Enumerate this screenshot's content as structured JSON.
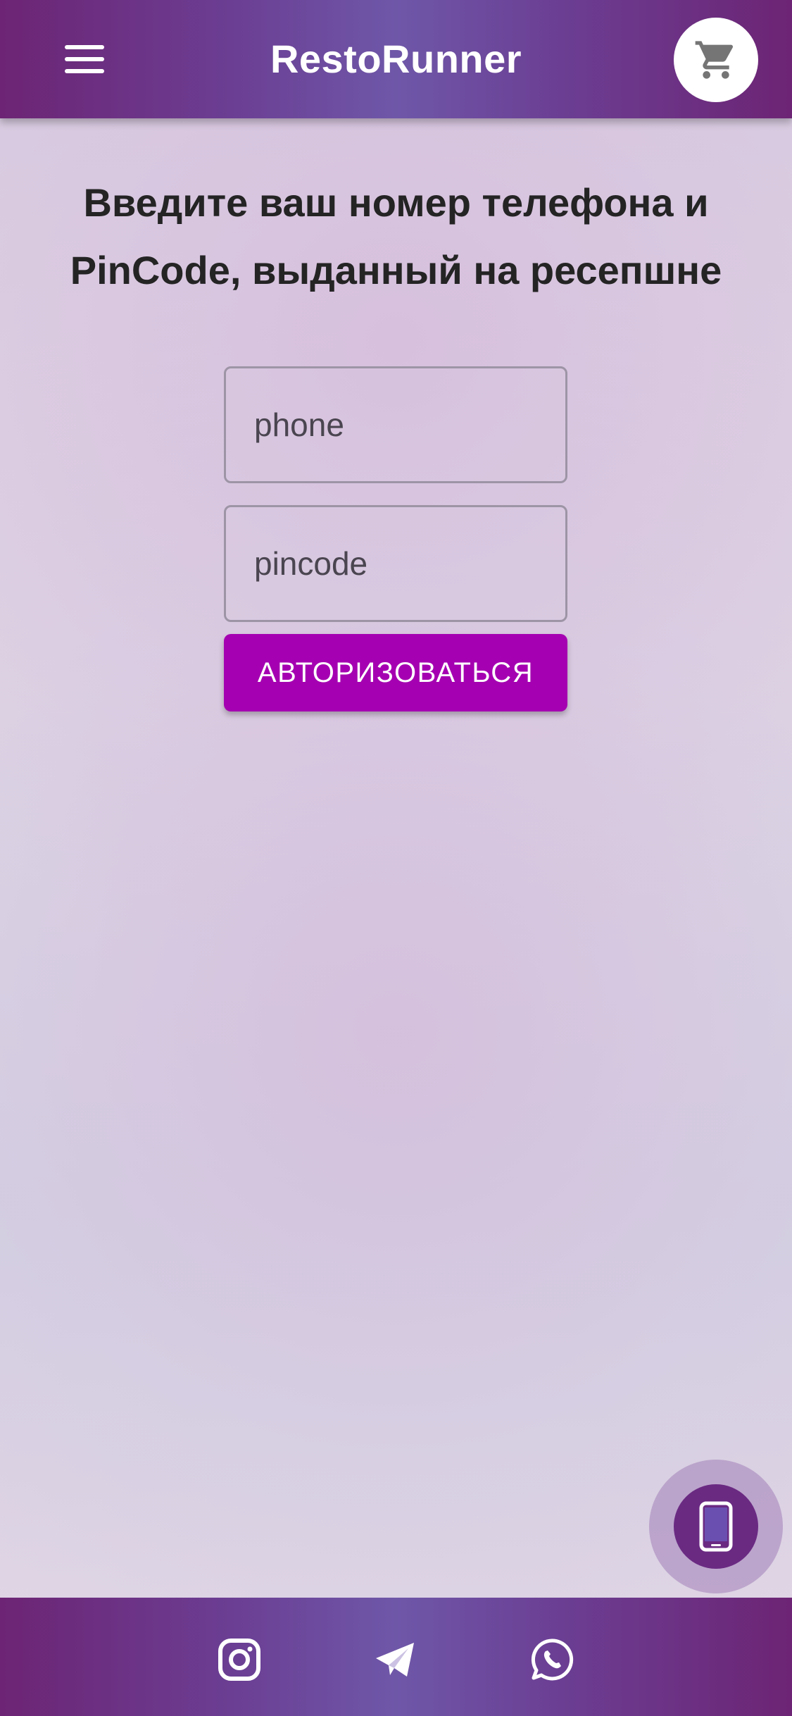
{
  "header": {
    "title": "RestoRunner",
    "menu_icon": "hamburger-menu-icon",
    "cart_icon": "shopping-cart-icon"
  },
  "login": {
    "instructions": "Введите ваш номер телефона и PinCode, выданный на ресепшне",
    "phone_placeholder": "phone",
    "pincode_placeholder": "pincode",
    "submit_label": "АВТОРИЗОВАТЬСЯ"
  },
  "fab": {
    "icon": "mobile-phone-icon"
  },
  "footer": {
    "social": [
      "instagram-icon",
      "telegram-icon",
      "whatsapp-icon"
    ]
  },
  "colors": {
    "header_bg": "#6f57a8",
    "accent_button": "#a500b1",
    "fab_bg": "#6a2a82",
    "text_dark": "#242424"
  }
}
